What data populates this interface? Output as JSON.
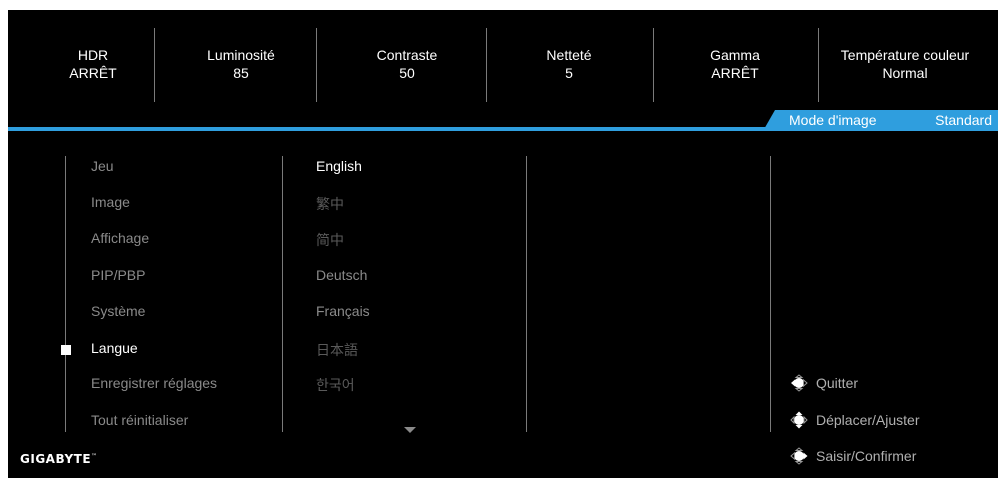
{
  "status": [
    {
      "label": "HDR",
      "value": "ARRÊT"
    },
    {
      "label": "Luminosité",
      "value": "85"
    },
    {
      "label": "Contraste",
      "value": "50"
    },
    {
      "label": "Netteté",
      "value": "5"
    },
    {
      "label": "Gamma",
      "value": "ARRÊT"
    },
    {
      "label": "Température couleur",
      "value": "Normal"
    }
  ],
  "picture_mode": {
    "label": "Mode d'image",
    "value": "Standard"
  },
  "main_menu": [
    "Jeu",
    "Image",
    "Affichage",
    "PIP/PBP",
    "Système",
    "Langue",
    "Enregistrer réglages",
    "Tout réinitialiser"
  ],
  "main_menu_selected": "Langue",
  "languages": [
    "English",
    "繁中",
    "简中",
    "Deutsch",
    "Français",
    "日本語",
    "한국어"
  ],
  "language_selected": "English",
  "hints": {
    "exit": "Quitter",
    "move_adjust": "Déplacer/Ajuster",
    "enter_confirm": "Saisir/Confirmer"
  },
  "brand": {
    "name": "GIGABYTE",
    "mark": "™"
  },
  "colors": {
    "accent": "#2f9ede",
    "background": "#000000",
    "text": "#ffffff",
    "dim_text": "#8a8a8a"
  }
}
